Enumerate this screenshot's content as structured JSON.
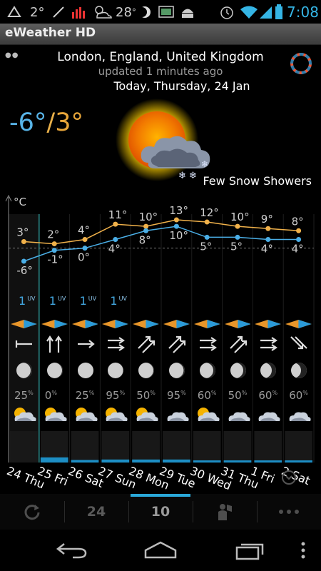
{
  "status_bar": {
    "temp1": "2°",
    "temp2": "28",
    "temp2_unit": "°",
    "clock": "7:08"
  },
  "app": {
    "title": "eWeather HD"
  },
  "header": {
    "location": "London, England, United Kingdom",
    "updated": "updated 1 minutes ago",
    "today": "Today, Thursday, 24 Jan"
  },
  "current": {
    "low": "-6°",
    "separator": "/",
    "high": "3°",
    "condition": "Few Snow Showers",
    "icon": "sun-with-snow-cloud-icon"
  },
  "forecast": {
    "unit_label": "°C",
    "colors": {
      "high": "#f0b14a",
      "low": "#4aaee6"
    },
    "days": [
      {
        "label": "24 Thu",
        "high": 3,
        "low": -6,
        "high_label": "3°",
        "low_label": "-6°",
        "uv": "1",
        "uv_unit": "UV",
        "wind": "arrow-left",
        "moon": 0.9,
        "precip": "25",
        "precip_unit": "%",
        "icon": "sun-snow-icon",
        "bar": 0
      },
      {
        "label": "25 Fri",
        "high": 2,
        "low": -1,
        "high_label": "2°",
        "low_label": "-1°",
        "uv": "1",
        "uv_unit": "UV",
        "wind": "arrows-up",
        "moon": 0.95,
        "precip": "0",
        "precip_unit": "%",
        "icon": "sun-cloud-icon",
        "bar": 0.6
      },
      {
        "label": "26 Sat",
        "high": 4,
        "low": 0,
        "high_label": "4°",
        "low_label": "0°",
        "uv": "1",
        "uv_unit": "UV",
        "wind": "arrow-right",
        "moon": 1.0,
        "precip": "25",
        "precip_unit": "%",
        "icon": "sun-cloud-icon",
        "bar": 0.3
      },
      {
        "label": "27 Sun",
        "high": 11,
        "low": 4,
        "high_label": "11°",
        "low_label": "4°",
        "uv": "1",
        "uv_unit": "UV",
        "wind": "arrows-right",
        "moon": 0.98,
        "precip": "95",
        "precip_unit": "%",
        "icon": "sun-rain-cloud-icon",
        "bar": 0.35
      },
      {
        "label": "28 Mon",
        "high": 10,
        "low": 8,
        "high_label": "10°",
        "low_label": "8°",
        "uv": "",
        "uv_unit": "",
        "wind": "arrows-diag",
        "moon": 0.95,
        "precip": "50",
        "precip_unit": "%",
        "icon": "sun-rain-cloud-icon",
        "bar": 0.35
      },
      {
        "label": "29 Tue",
        "high": 13,
        "low": 10,
        "high_label": "13°",
        "low_label": "10°",
        "uv": "",
        "uv_unit": "",
        "wind": "arrows-diag",
        "moon": 0.92,
        "precip": "95",
        "precip_unit": "%",
        "icon": "rain-cloud-icon",
        "bar": 0.35
      },
      {
        "label": "30 Wed",
        "high": 12,
        "low": 5,
        "high_label": "12°",
        "low_label": "5°",
        "uv": "",
        "uv_unit": "",
        "wind": "arrows-right",
        "moon": 0.85,
        "precip": "60",
        "precip_unit": "%",
        "icon": "sun-cloud-icon",
        "bar": 0.1
      },
      {
        "label": "31 Thu",
        "high": 10,
        "low": 5,
        "high_label": "10°",
        "low_label": "5°",
        "uv": "",
        "uv_unit": "",
        "wind": "arrows-diag",
        "moon": 0.8,
        "precip": "50",
        "precip_unit": "%",
        "icon": "rain-cloud-icon",
        "bar": 0.1
      },
      {
        "label": "1 Fri",
        "high": 9,
        "low": 4,
        "high_label": "9°",
        "low_label": "4°",
        "uv": "",
        "uv_unit": "",
        "wind": "arrows-right",
        "moon": 0.7,
        "precip": "60",
        "precip_unit": "%",
        "icon": "rain-cloud-icon",
        "bar": 0.1
      },
      {
        "label": "2 Sat",
        "high": 8,
        "low": 4,
        "high_label": "8°",
        "low_label": "4°",
        "uv": "",
        "uv_unit": "",
        "wind": "arrows-diag-down",
        "moon": 0.6,
        "precip": "60",
        "precip_unit": "%",
        "icon": "rain-cloud-icon",
        "bar": 0.05
      }
    ]
  },
  "toolbar": {
    "refresh_icon": "refresh-icon",
    "days24": "24",
    "days10": "10",
    "map_icon": "person-map-icon",
    "more_icon": "more-icon"
  },
  "navbar": {
    "back": "back-icon",
    "home": "home-icon",
    "recents": "recents-icon",
    "menu": "menu-icon"
  }
}
